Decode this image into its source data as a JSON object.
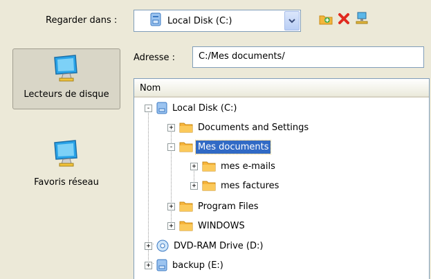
{
  "top": {
    "lookin_label": "Regarder dans :",
    "drive_select": "Local Disk (C:)"
  },
  "toolbar": {
    "icons": [
      "new-folder-icon",
      "delete-icon",
      "network-icon"
    ]
  },
  "nav": {
    "items": [
      {
        "label": "Lecteurs de disque",
        "icon": "monitor-icon",
        "selected": true
      },
      {
        "label": "Favoris réseau",
        "icon": "monitor-icon",
        "selected": false
      }
    ]
  },
  "address": {
    "label": "Adresse :",
    "value": "C:/Mes documents/"
  },
  "tree": {
    "column_header": "Nom",
    "nodes": [
      {
        "label": "Local Disk (C:)",
        "icon": "disk-icon",
        "toggle": "-"
      },
      {
        "label": "Documents and Settings",
        "icon": "folder-icon",
        "toggle": "+"
      },
      {
        "label": "Mes documents",
        "icon": "folder-icon",
        "toggle": "-",
        "selected": true
      },
      {
        "label": "mes e-mails",
        "icon": "folder-icon",
        "toggle": "+"
      },
      {
        "label": "mes factures",
        "icon": "folder-icon",
        "toggle": "+"
      },
      {
        "label": "Program Files",
        "icon": "folder-icon",
        "toggle": "+"
      },
      {
        "label": "WINDOWS",
        "icon": "folder-icon",
        "toggle": "+"
      },
      {
        "label": "DVD-RAM Drive (D:)",
        "icon": "dvd-icon",
        "toggle": "+"
      },
      {
        "label": "backup (E:)",
        "icon": "disk-icon",
        "toggle": "+"
      }
    ]
  },
  "colors": {
    "background": "#ece9d8",
    "selection": "#316ac5",
    "folder": "#f7b43b",
    "border": "#7f9db9"
  }
}
